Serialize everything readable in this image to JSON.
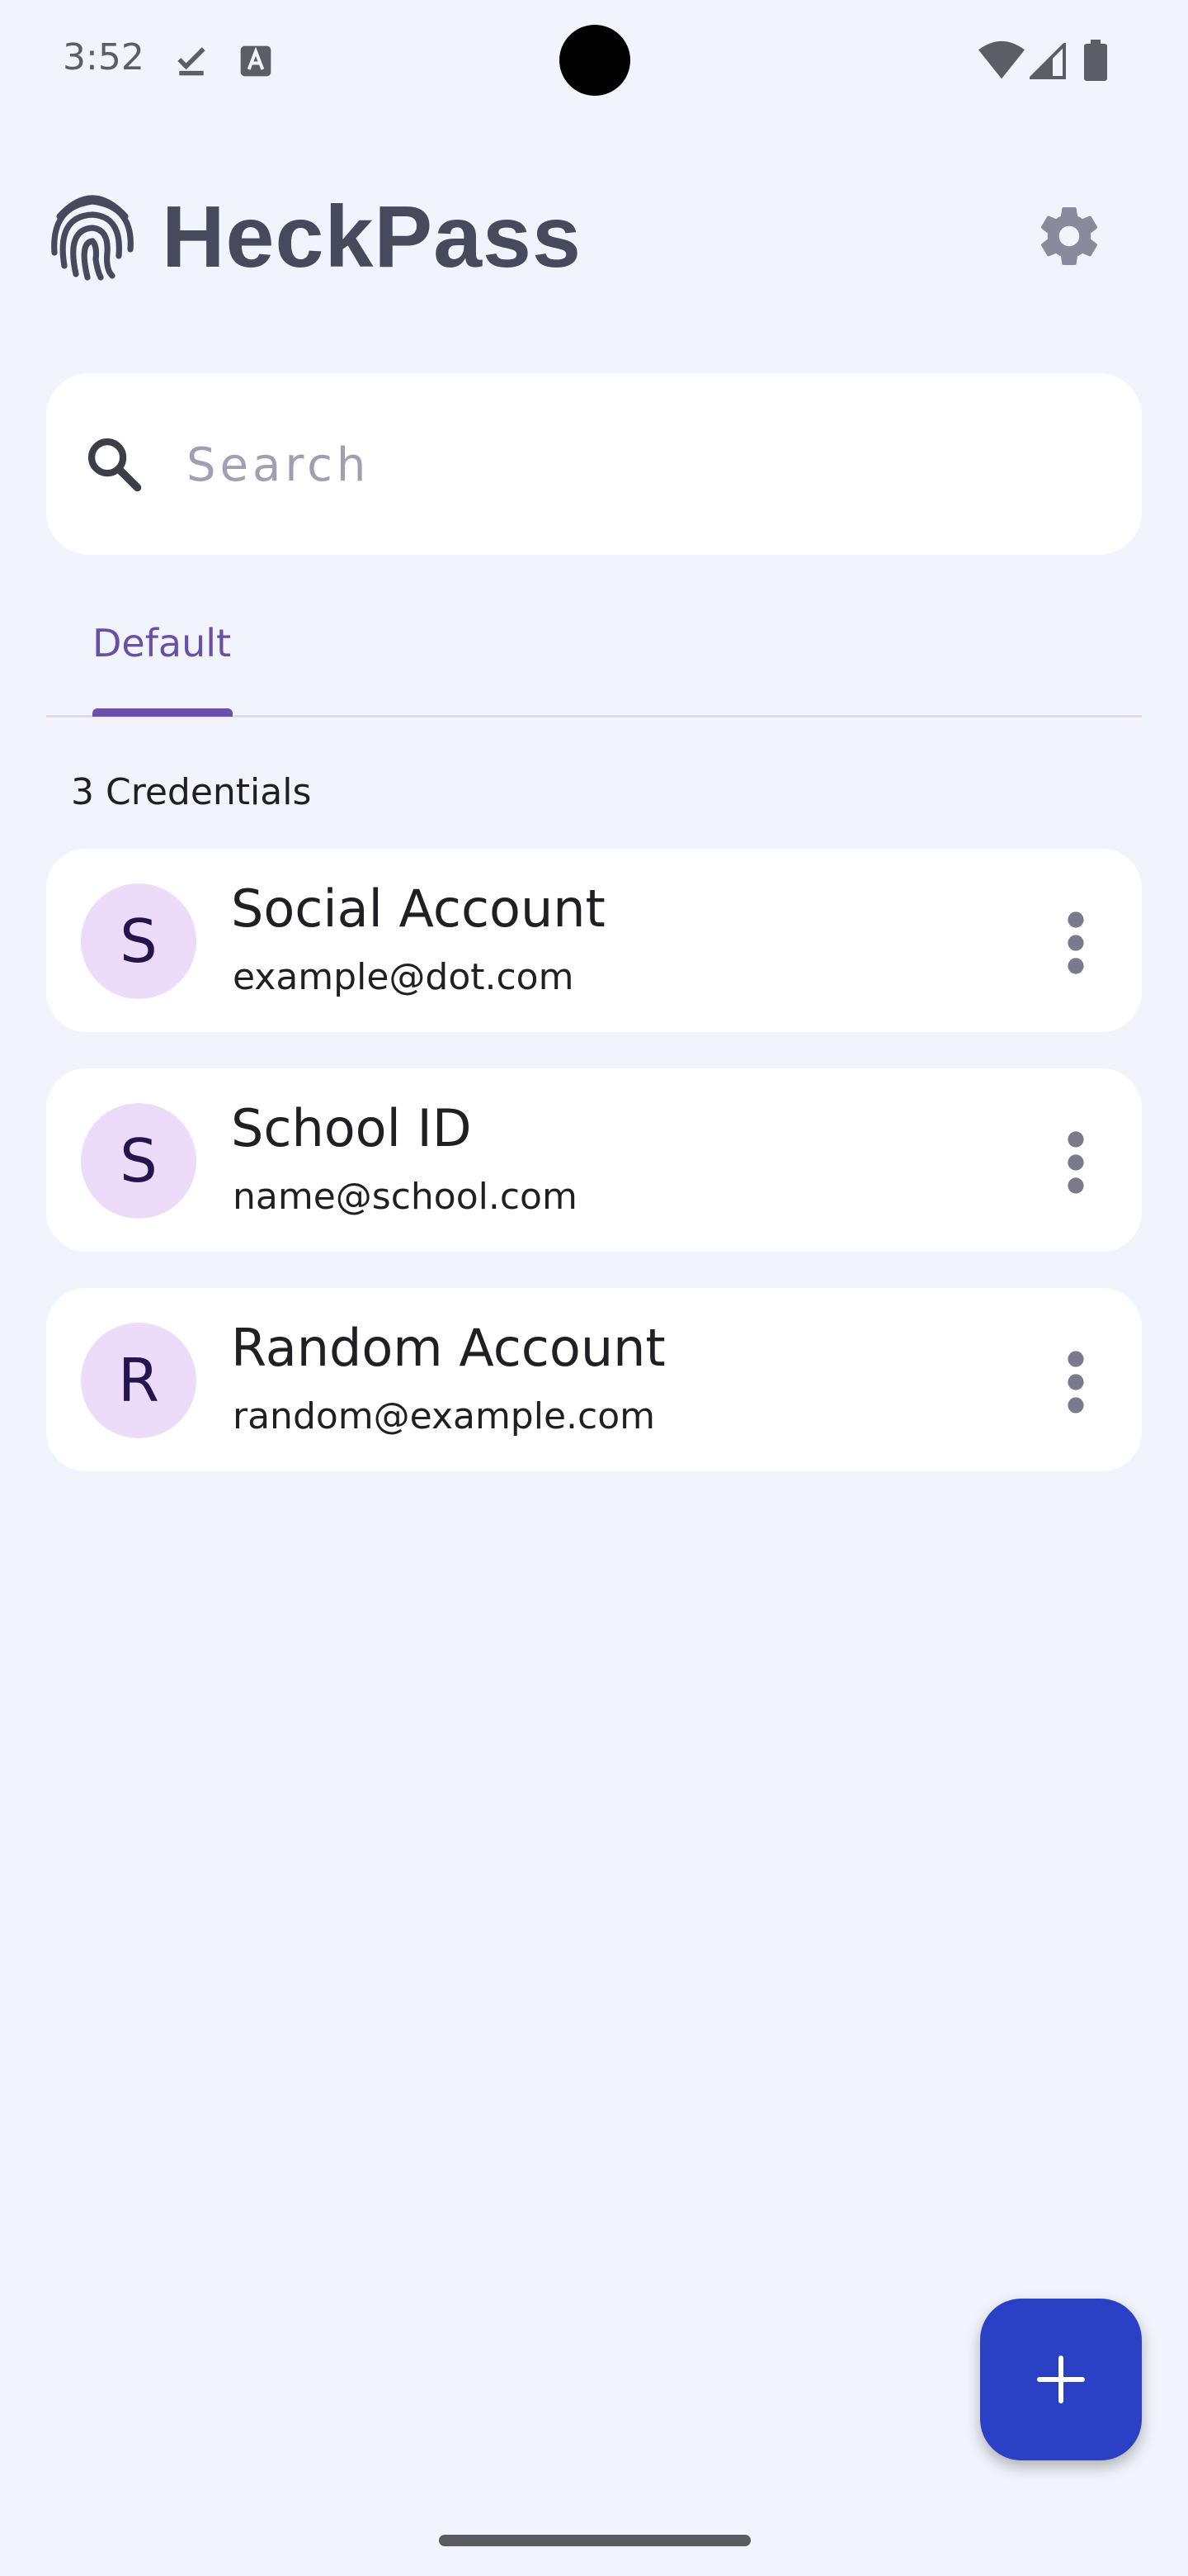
{
  "status_bar": {
    "time": "3:52",
    "icons": [
      "download-done-icon",
      "text-a-icon",
      "wifi-icon",
      "cellular-signal-icon",
      "battery-icon"
    ]
  },
  "app": {
    "title": "HeckPass",
    "logo_icon": "fingerprint-icon",
    "settings_icon": "gear-icon"
  },
  "search": {
    "placeholder": "Search",
    "value": ""
  },
  "tabs": [
    {
      "label": "Default",
      "selected": true
    }
  ],
  "credentials": {
    "count_label": "3 Credentials",
    "items": [
      {
        "initial": "S",
        "title": "Social Account",
        "subtitle": "example@dot.com"
      },
      {
        "initial": "S",
        "title": "School ID",
        "subtitle": "name@school.com"
      },
      {
        "initial": "R",
        "title": "Random Account",
        "subtitle": "random@example.com"
      }
    ]
  },
  "fab": {
    "icon": "plus-icon"
  },
  "colors": {
    "background": "#f2f4fd",
    "accent": "#6a4fa6",
    "fab": "#2a41c6",
    "avatar_bg": "#ecdcfa",
    "title_text": "#464a5c"
  }
}
